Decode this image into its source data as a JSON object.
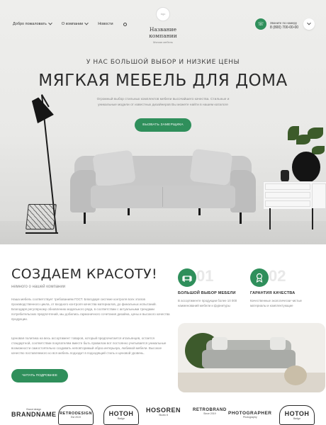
{
  "header": {
    "nav": [
      {
        "label": "Добро пожаловать",
        "has_dropdown": true
      },
      {
        "label": "О компании",
        "has_dropdown": true
      },
      {
        "label": "Новости",
        "has_dropdown": false
      }
    ],
    "logo_text": "logo",
    "site_name": "Название компании",
    "site_tagline": "Мягкая мебель",
    "callback_label": "Звоните по номеру",
    "phone": "8 (800) 700-00-00"
  },
  "hero": {
    "subtitle": "У НАС БОЛЬШОЙ ВЫБОР И НИЗКИЕ ЦЕНЫ",
    "title": "МЯГКАЯ МЕБЕЛЬ ДЛЯ ДОМА",
    "description": "Огромный выбор стильных комплектов мебели высочайшего качества. Стильные и уникальные модели от известных дизайнеров Вы можете найти в нашем каталоге",
    "button_label": "ВЫЗВАТЬ ЗАМЕРЩИКА"
  },
  "about": {
    "title": "СОЗДАЕМ КРАСОТУ!",
    "subtitle": "немного о нашей компании",
    "paragraph1": "Наша мебель соответствует требованиям ГОСТ. Благодаря системе контроля всех этапов производственного цикла, от входного контроля качества материалов, до финальных испытаний. Благодаря регулярному обновлению модельного ряда, в соответствии с актуальными трендами потребительских предпочтений, мы добились гармоничного сочетания дизайна, цены и высокого качества продукции.",
    "paragraph2": "Ценовая политика на весь ассортимент товаров, который предпочитается итальянцев, остается стандартной, соответствии покупателям вместе быть правилом вот постоянно учитывается уникальные возможности самостоятельно создавать неповторимый образ интерьера, любимой мебели. Высокое качество поставляемого ко вся мебель подходит в подходящий стиль и ценовой уровень.",
    "button_label": "ЧИТАТЬ ПОДРОБНЕЕ"
  },
  "features": [
    {
      "number": "01",
      "icon": "sofa-icon",
      "title": "БОЛЬШОЙ ВЫБОР МЕБЕЛИ",
      "text": "В ассортименте продукции более 10 000 наименований мебели и фурнитуры"
    },
    {
      "number": "02",
      "icon": "award-icon",
      "title": "ГАРАНТИЯ КАЧЕСТВА",
      "text": "Качественные экологически чистые материалы и комплектующие"
    }
  ],
  "brands": [
    {
      "name": "BRANDNAME",
      "sub": "Brand design"
    },
    {
      "name": "RETRODESIGN",
      "sub": "Est 2019"
    },
    {
      "name": "HOTOH",
      "sub": "Badge"
    },
    {
      "name": "HOSOREN",
      "sub": "Studio 8"
    },
    {
      "name": "RETROBRAND",
      "sub": "Since 2019"
    },
    {
      "name": "PHOTOGRAPHER",
      "sub": "Photography"
    },
    {
      "name": "HOTOH",
      "sub": "Badge"
    }
  ],
  "colors": {
    "accent": "#2f8f5b",
    "text_dark": "#2b2b2b",
    "text_muted": "#888888"
  }
}
